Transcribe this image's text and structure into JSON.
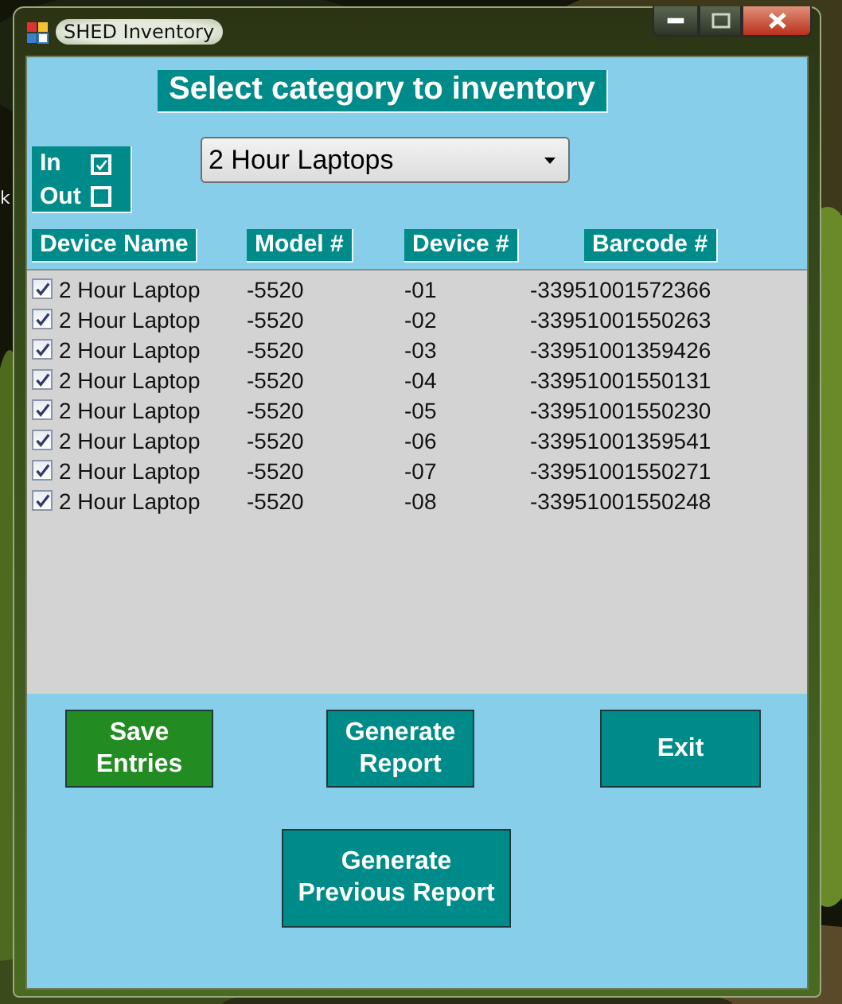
{
  "desktop": {
    "kind": "picture",
    "label": "k"
  },
  "window": {
    "title": "SHED Inventory"
  },
  "heading": "Select category to inventory",
  "category": {
    "value": "2 Hour Laptops"
  },
  "filters": [
    {
      "label": "In",
      "checked": true
    },
    {
      "label": "Out",
      "checked": false
    }
  ],
  "columns": [
    "Device Name",
    "Model #",
    "Device #",
    "Barcode #"
  ],
  "rows": [
    {
      "checked": true,
      "cells": [
        "2 Hour Laptop",
        "-5520",
        "-01",
        "-33951001572366"
      ]
    },
    {
      "checked": true,
      "cells": [
        "2 Hour Laptop",
        "-5520",
        "-02",
        "-33951001550263"
      ]
    },
    {
      "checked": true,
      "cells": [
        "2 Hour Laptop",
        "-5520",
        "-03",
        "-33951001359426"
      ]
    },
    {
      "checked": true,
      "cells": [
        "2 Hour Laptop",
        "-5520",
        "-04",
        "-33951001550131"
      ]
    },
    {
      "checked": true,
      "cells": [
        "2 Hour Laptop",
        "-5520",
        "-05",
        "-33951001550230"
      ]
    },
    {
      "checked": true,
      "cells": [
        "2 Hour Laptop",
        "-5520",
        "-06",
        "-33951001359541"
      ]
    },
    {
      "checked": true,
      "cells": [
        "2 Hour Laptop",
        "-5520",
        "-07",
        "-33951001550271"
      ]
    },
    {
      "checked": true,
      "cells": [
        "2 Hour Laptop",
        "-5520",
        "-08",
        "-33951001550248"
      ]
    }
  ],
  "buttons": [
    {
      "label": "Save Entries",
      "color": "#228b22"
    },
    {
      "label": "Generate Report",
      "color": "#008b8b"
    },
    {
      "label": "Exit",
      "color": "#008b8b"
    },
    {
      "label": "Generate Previous Report",
      "color": "#008b8b"
    }
  ]
}
